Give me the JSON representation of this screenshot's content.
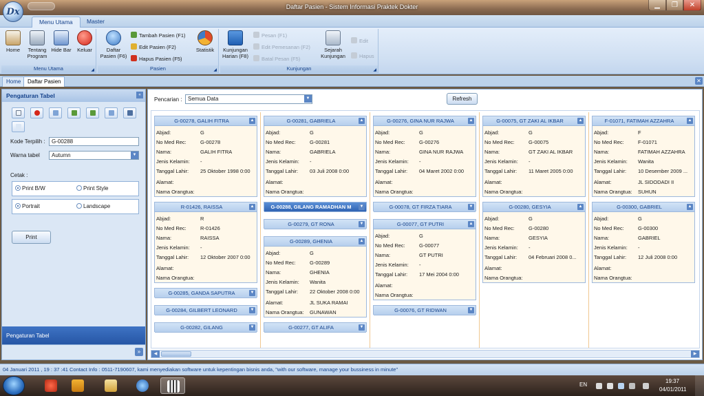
{
  "window": {
    "title": "Daftar Pasien - Sistem Informasi Praktek Dokter",
    "logo_text": "Dx"
  },
  "ribbon": {
    "tabs": [
      {
        "label": "Menu Utama"
      },
      {
        "label": "Master"
      }
    ],
    "groups": {
      "menu_utama": {
        "label": "Menu Utama",
        "buttons": {
          "home": "Home",
          "tentang": "Tentang Program",
          "hidebar": "Hide Bar",
          "keluar": "Keluar"
        }
      },
      "pasien": {
        "label": "Pasien",
        "daftar": "Daftar Pasien (F6)",
        "tambah": "Tambah Pasien (F1)",
        "edit": "Edit Pasien (F2)",
        "hapus": "Hapus Pasien (F5)",
        "statistik": "Statistik"
      },
      "kunjungan": {
        "label": "Kunjungan",
        "harian": "Kunjungan Harian (F8)",
        "pesan": "Pesan (F1)",
        "edit_pemesanan": "Edit Pemesanan (F2)",
        "batal": "Batal Pesan (F5)",
        "sejarah": "Sejarah Kunjungan",
        "edit": "Edit",
        "hapus": "Hapus"
      }
    }
  },
  "doc_tabs": [
    {
      "label": "Home"
    },
    {
      "label": "Daftar Pasien"
    }
  ],
  "left_panel": {
    "title": "Pengaturan Tabel",
    "kode_label": "Kode Terpilih :",
    "kode_value": "G-00288",
    "warna_label": "Warna tabel",
    "warna_value": "Autumn",
    "cetak_label": "Cetak :",
    "print_bw": "Print B/W",
    "print_style": "Print Style",
    "portrait": "Portrait",
    "landscape": "Landscape",
    "print_button": "Print",
    "footer": "Pengaturan Tabel"
  },
  "main": {
    "search_label": "Pencarian :",
    "search_value": "Semua Data",
    "refresh_label": "Refresh"
  },
  "field_labels": {
    "abjad": "Abjad:",
    "no_med_rec": "No Med Rec:",
    "nama": "Nama:",
    "jenis_kelamin": "Jenis Kelamin:",
    "tanggal_lahir": "Tanggal Lahir:",
    "alamat": "Alamat:",
    "nama_orangtua": "Nama Orangtua:"
  },
  "cards": {
    "c0_0": {
      "title": "G-00278, GALIH FITRA",
      "abjad": "G",
      "no_med_rec": "G-00278",
      "nama": "GALIH FITRA",
      "jenis_kelamin": "-",
      "tanggal_lahir": "25 Oktober 1998 0:00",
      "alamat": "",
      "nama_orangtua": ""
    },
    "c0_1": {
      "title": "R-01426, RAISSA",
      "abjad": "R",
      "no_med_rec": "R-01426",
      "nama": "RAISSA",
      "jenis_kelamin": "-",
      "tanggal_lahir": "12 Oktober 2007 0:00",
      "alamat": "",
      "nama_orangtua": ""
    },
    "c0_2": {
      "title": "G-00285, GANDA SAPUTRA"
    },
    "c0_3": {
      "title": "G-00284, GILBERT LEONARD"
    },
    "c0_4": {
      "title": "G-00282, GILANG"
    },
    "c1_0": {
      "title": "G-00281, GABRIELA",
      "abjad": "G",
      "no_med_rec": "G-00281",
      "nama": "GABRIELA",
      "jenis_kelamin": "-",
      "tanggal_lahir": "03 Juli 2008 0:00",
      "alamat": "",
      "nama_orangtua": ""
    },
    "c1_1": {
      "title": "G-00288, GILANG RAMADHAN M"
    },
    "c1_2": {
      "title": "G-00279, GT RONA"
    },
    "c1_3": {
      "title": "G-00289, GHENIA",
      "abjad": "G",
      "no_med_rec": "G-00289",
      "nama": "GHENIA",
      "jenis_kelamin": "Wanita",
      "tanggal_lahir": "22 Oktober 2008 0:00",
      "alamat": "JL SUKA RAMAI",
      "nama_orangtua": "GUNAWAN"
    },
    "c1_4": {
      "title": "G-00277, GT ALIFA"
    },
    "c2_0": {
      "title": "G-00276, GINA NUR RAJWA",
      "abjad": "G",
      "no_med_rec": "G-00276",
      "nama": "GINA NUR RAJWA",
      "jenis_kelamin": "-",
      "tanggal_lahir": "04 Maret 2002 0:00",
      "alamat": "",
      "nama_orangtua": ""
    },
    "c2_1": {
      "title": "G-00078, GT FIRZA TIARA"
    },
    "c2_2": {
      "title": "G-00077, GT PUTRI",
      "abjad": "G",
      "no_med_rec": "G-00077",
      "nama": "GT PUTRI",
      "jenis_kelamin": "-",
      "tanggal_lahir": "17 Mei 2004 0:00",
      "alamat": "",
      "nama_orangtua": ""
    },
    "c2_3": {
      "title": "G-00076, GT RIDWAN"
    },
    "c3_0": {
      "title": "G-00075, GT ZAKI AL IKBAR",
      "abjad": "G",
      "no_med_rec": "G-00075",
      "nama": "GT ZAKI AL IKBAR",
      "jenis_kelamin": "-",
      "tanggal_lahir": "11 Maret 2005 0:00",
      "alamat": "",
      "nama_orangtua": ""
    },
    "c3_1": {
      "title": "G-00280, GESYIA",
      "abjad": "G",
      "no_med_rec": "G-00280",
      "nama": "GESYIA",
      "jenis_kelamin": "-",
      "tanggal_lahir": "04 Februari 2008 0...",
      "alamat": "",
      "nama_orangtua": ""
    },
    "c4_0": {
      "title": "F-01071, FATIMAH AZZAHRA",
      "abjad": "F",
      "no_med_rec": "F-01071",
      "nama": "FATIMAH AZZAHRA",
      "jenis_kelamin": "Wanita",
      "tanggal_lahir": "10 Desember 2009 ...",
      "alamat": "JL SIDODADI II",
      "nama_orangtua": "SUHUN"
    },
    "c4_1": {
      "title": "G-00300, GABRIEL",
      "abjad": "G",
      "no_med_rec": "G-00300",
      "nama": "GABRIEL",
      "jenis_kelamin": "-",
      "tanggal_lahir": "12 Juli 2008 0:00",
      "alamat": "",
      "nama_orangtua": ""
    }
  },
  "status": {
    "text": "04 Januari 2011 , 19 : 37 :41  Contact Info : 0511-7190607, kami menyediakan software untuk kepentingan bisnis anda, \"with our software, manage your bussiness in minute\""
  },
  "taskbar": {
    "lang": "EN",
    "time": "19:37",
    "date": "04/01/2011"
  },
  "colors": {
    "accent": "#15428b",
    "card_bg": "#fff8ea",
    "selected": "#2f63b3"
  }
}
